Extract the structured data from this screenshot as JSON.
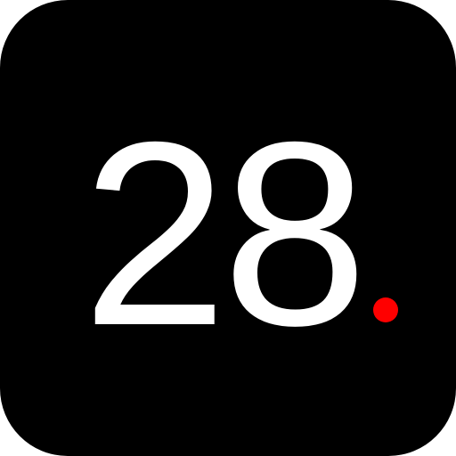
{
  "icon": {
    "label": "28",
    "background_color": "#000000",
    "text_color": "#ffffff",
    "dot_color": "#ff0000"
  }
}
